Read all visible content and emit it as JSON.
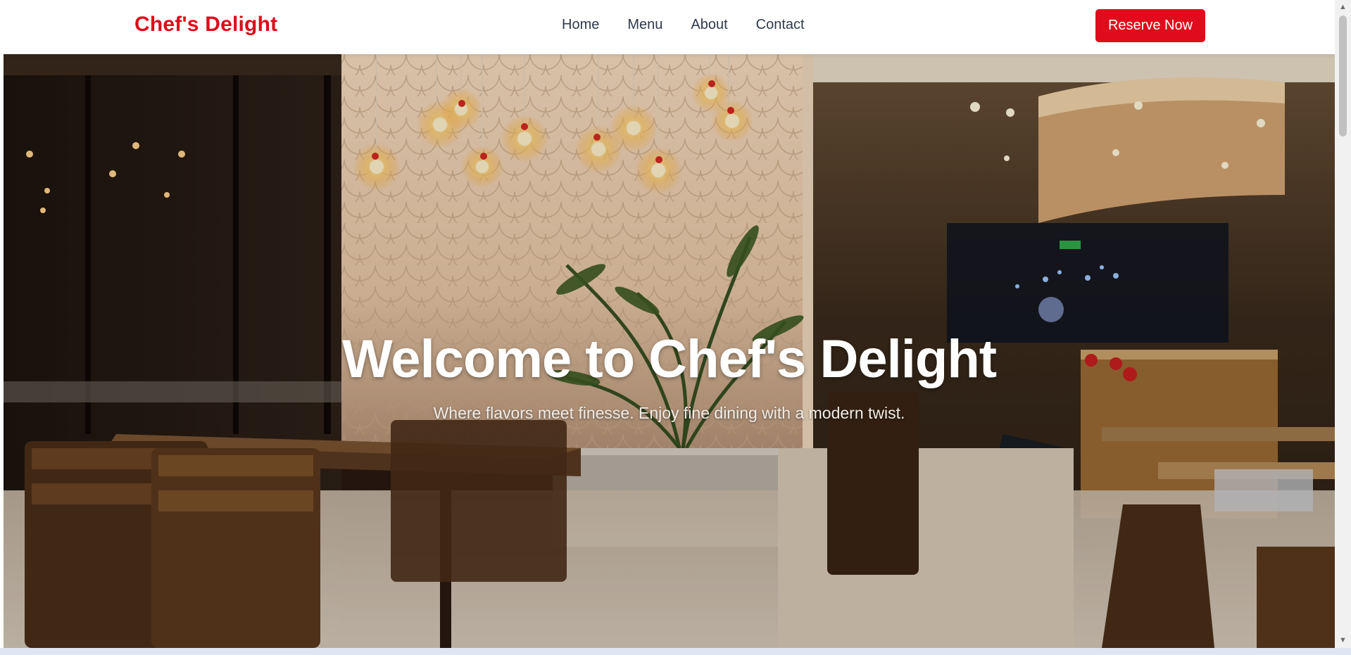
{
  "brand": {
    "name": "Chef's Delight"
  },
  "nav": {
    "links": [
      "Home",
      "Menu",
      "About",
      "Contact"
    ],
    "cta_label": "Reserve Now"
  },
  "hero": {
    "title": "Welcome to Chef's Delight",
    "subtitle": "Where flavors meet finesse. Enjoy fine dining with a modern twist.",
    "image_icon": "restaurant-interior-photo"
  },
  "colors": {
    "brand_red": "#e0081a",
    "nav_text": "#2f3a4a",
    "button_red": "#e00b1c",
    "hero_text": "#ffffff"
  },
  "scrollbar": {
    "up_icon": "chevron-up-icon",
    "down_icon": "chevron-down-icon"
  }
}
